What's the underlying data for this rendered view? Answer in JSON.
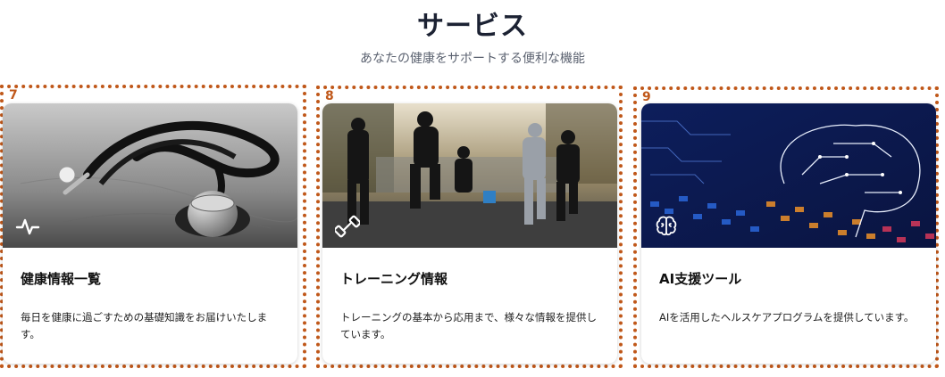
{
  "section": {
    "title": "サービス",
    "subtitle": "あなたの健康をサポートする便利な機能"
  },
  "cards": [
    {
      "marker": "7",
      "icon": "activity-pulse-icon",
      "image": "stethoscope-photo",
      "title": "健康情報一覧",
      "description": "毎日を健康に過ごすための基礎知識をお届けいたします。"
    },
    {
      "marker": "8",
      "icon": "dumbbell-icon",
      "image": "running-group-photo",
      "title": "トレーニング情報",
      "description": "トレーニングの基本から応用まで、様々な情報を提供しています。"
    },
    {
      "marker": "9",
      "icon": "brain-icon",
      "image": "ai-brain-circuit-image",
      "title": "AI支援ツール",
      "description": "AIを活用したヘルスケアプログラムを提供しています。"
    }
  ],
  "colors": {
    "marker": "#c0581a",
    "title": "#1c2233",
    "subtitle": "#5b6270"
  }
}
